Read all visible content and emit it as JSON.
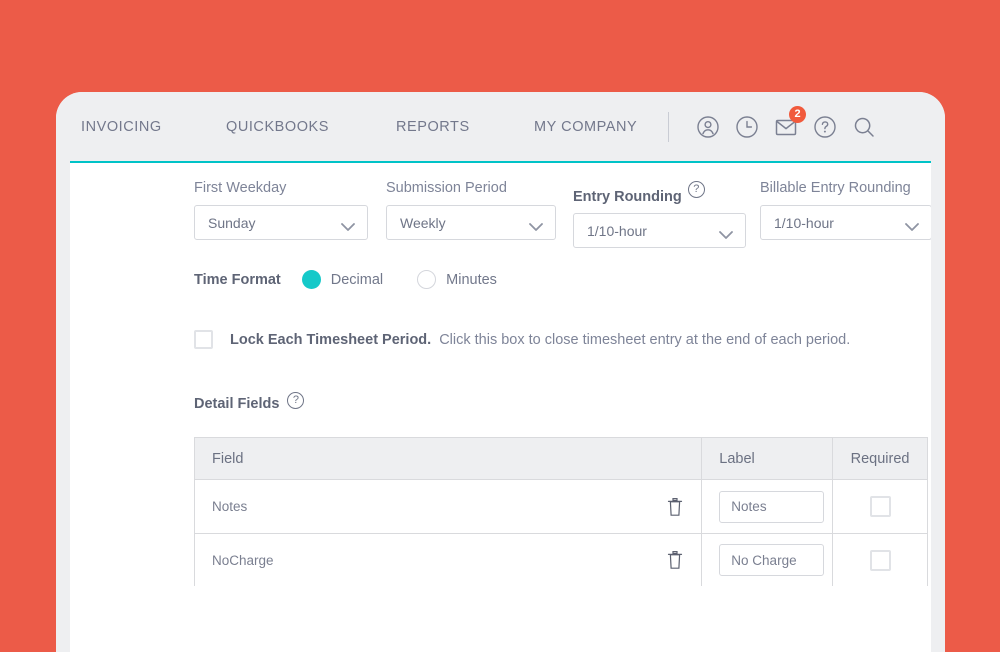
{
  "nav": {
    "links": [
      {
        "label": "INVOICING",
        "name": "nav-link-invoicing"
      },
      {
        "label": "QUICKBOOKS",
        "name": "nav-link-quickbooks"
      },
      {
        "label": "REPORTS",
        "name": "nav-link-reports"
      },
      {
        "label": "MY COMPANY",
        "name": "nav-link-my-company"
      }
    ],
    "icons": [
      {
        "name": "user-account-icon"
      },
      {
        "name": "clock-icon"
      },
      {
        "name": "mail-icon",
        "badge": "2"
      },
      {
        "name": "help-icon"
      },
      {
        "name": "search-icon"
      }
    ],
    "badge_count": "2"
  },
  "settings": {
    "first_weekday": {
      "label": "First Weekday",
      "value": "Sunday"
    },
    "submission_period": {
      "label": "Submission Period",
      "value": "Weekly"
    },
    "entry_rounding": {
      "label": "Entry Rounding",
      "value": "1/10-hour",
      "help": "?"
    },
    "billable_entry_rounding": {
      "label": "Billable Entry Rounding",
      "value": "1/10-hour"
    },
    "time_format": {
      "label": "Time Format",
      "options": [
        {
          "label": "Decimal",
          "selected": true
        },
        {
          "label": "Minutes",
          "selected": false
        }
      ]
    },
    "lock_period": {
      "strong": "Lock Each Timesheet Period.",
      "hint": "Click this box to close timesheet entry at the end of each period.",
      "checked": false
    }
  },
  "detail_fields": {
    "title": "Detail Fields",
    "help": "?",
    "columns": [
      "Field",
      "Label",
      "Required"
    ],
    "rows": [
      {
        "field": "Notes",
        "label": "Notes",
        "required": false
      },
      {
        "field": "NoCharge",
        "label": "No Charge",
        "required": false
      }
    ]
  },
  "colors": {
    "page_background": "#ec5b48",
    "card_header": "#eeeff1",
    "accent_teal": "#00c3c7",
    "radio_selected": "#15c9c9",
    "badge_red": "#f15a3c",
    "text_muted": "#7e8498",
    "text_strong": "#5e6475"
  }
}
